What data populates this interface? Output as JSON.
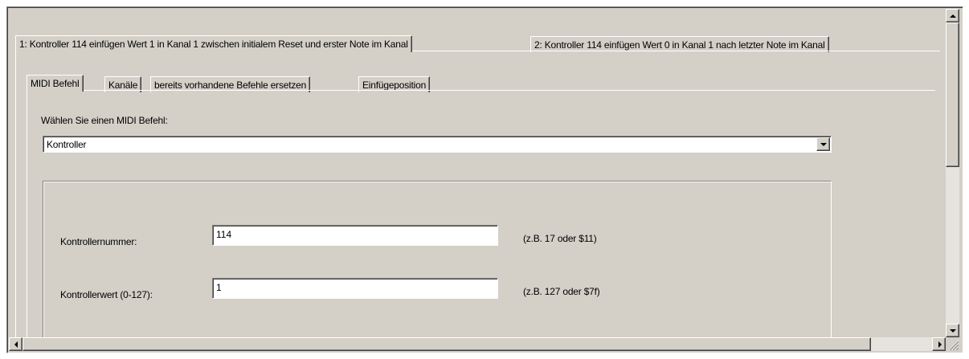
{
  "outer_tabs": [
    {
      "label": "1: Kontroller 114 einfügen Wert 1 in Kanal 1 zwischen initialem Reset und erster Note im Kanal",
      "active": true
    },
    {
      "label": "2: Kontroller 114 einfügen Wert 0 in Kanal 1 nach letzter Note im Kanal",
      "active": false
    }
  ],
  "inner_tabs": [
    {
      "label": "MIDI Befehl",
      "active": true
    },
    {
      "label": "Kanäle",
      "active": false
    },
    {
      "label": "bereits vorhandene Befehle ersetzen",
      "active": false
    },
    {
      "label": "Einfügeposition",
      "active": false
    }
  ],
  "midi_command": {
    "prompt": "Wählen Sie einen MIDI Befehl:",
    "selected": "Kontroller"
  },
  "fields": [
    {
      "label": "Kontrollernummer:",
      "value": "114",
      "hint": "(z.B. 17 oder $11)"
    },
    {
      "label": "Kontrollerwert (0-127):",
      "value": "1",
      "hint": "(z.B. 127 oder $7f)"
    }
  ],
  "colors": {
    "face": "#d4d0c8",
    "highlight": "#ffffff",
    "shadow": "#808080",
    "dark_shadow": "#404040",
    "scroll_track": "#e6e3de"
  }
}
